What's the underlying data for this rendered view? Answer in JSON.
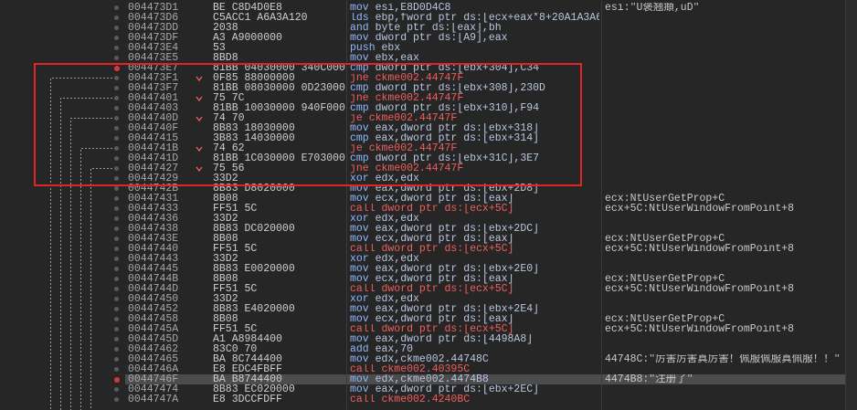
{
  "colors": {
    "background": "#262626",
    "address": "#a8a8a8",
    "bytes": "#cfcfcf",
    "mnemonic": "#8fb8ff",
    "operands": "#b9c6e0",
    "jump": "#ee5f5b",
    "comment": "#c8c8c8",
    "selected_row": "#4c4c4c",
    "breakpoint": "#e03434",
    "dot": "#5a5a5a",
    "annotation": "#e02525",
    "jump_line": "#9c9c9c"
  },
  "rows": [
    {
      "addr": "004473D1",
      "bytes": "BE C8D4D0E8",
      "mnem": "mov",
      "ops": "esi,E8D0D4C8",
      "comment": "esi:\"U褒翘頫,uD\""
    },
    {
      "addr": "004473D6",
      "bytes": "C5ACC1 A6A3A120",
      "mnem": "lds",
      "ops": "ebp,fword ptr ds:[ecx+eax*8+20A1A3A6"
    },
    {
      "addr": "004473DD",
      "bytes": "2038",
      "mnem": "and",
      "ops": "byte ptr ds:[eax],bh"
    },
    {
      "addr": "004473DF",
      "bytes": "A3 A9000000",
      "mnem": "mov",
      "ops": "dword ptr ds:[A9],eax"
    },
    {
      "addr": "004473E4",
      "bytes": "53",
      "mnem": "push",
      "ops": "ebx"
    },
    {
      "addr": "004473E5",
      "bytes": "8BD8",
      "mnem": "mov",
      "ops": "ebx,eax"
    },
    {
      "addr": "004473E7",
      "bytes": "81BB 04030000 340C000",
      "mnem": "cmp",
      "ops": "dword ptr ds:[ebx+304],C34",
      "breakpoint": true
    },
    {
      "addr": "004473F1",
      "bytes": "0F85 88000000",
      "mnem": "jne",
      "ops": "ckme002.44747F",
      "kind": "jcc"
    },
    {
      "addr": "004473F7",
      "bytes": "81BB 08030000 0D23000",
      "mnem": "cmp",
      "ops": "dword ptr ds:[ebx+308],230D"
    },
    {
      "addr": "00447401",
      "bytes": "75 7C",
      "mnem": "jne",
      "ops": "ckme002.44747F",
      "kind": "jcc"
    },
    {
      "addr": "00447403",
      "bytes": "81BB 10030000 940F000",
      "mnem": "cmp",
      "ops": "dword ptr ds:[ebx+310],F94"
    },
    {
      "addr": "0044740D",
      "bytes": "74 70",
      "mnem": "je",
      "ops": "ckme002.44747F",
      "kind": "jcc"
    },
    {
      "addr": "0044740F",
      "bytes": "8B83 18030000",
      "mnem": "mov",
      "ops": "eax,dword ptr ds:[ebx+318]"
    },
    {
      "addr": "00447415",
      "bytes": "3B83 14030000",
      "mnem": "cmp",
      "ops": "eax,dword ptr ds:[ebx+314]"
    },
    {
      "addr": "0044741B",
      "bytes": "74 62",
      "mnem": "je",
      "ops": "ckme002.44747F",
      "kind": "jcc"
    },
    {
      "addr": "0044741D",
      "bytes": "81BB 1C030000 E703000",
      "mnem": "cmp",
      "ops": "dword ptr ds:[ebx+31C],3E7"
    },
    {
      "addr": "00447427",
      "bytes": "75 56",
      "mnem": "jne",
      "ops": "ckme002.44747F",
      "kind": "jcc"
    },
    {
      "addr": "00447429",
      "bytes": "33D2",
      "mnem": "xor",
      "ops": "edx,edx"
    },
    {
      "addr": "0044742B",
      "bytes": "8B83 D8020000",
      "mnem": "mov",
      "ops": "eax,dword ptr ds:[ebx+2D8]"
    },
    {
      "addr": "00447431",
      "bytes": "8B08",
      "mnem": "mov",
      "ops": "ecx,dword ptr ds:[eax]",
      "comment": "ecx:NtUserGetProp+C"
    },
    {
      "addr": "00447433",
      "bytes": "FF51 5C",
      "mnem": "call",
      "ops": "dword ptr ds:[ecx+5C]",
      "comment": "ecx+5C:NtUserWindowFromPoint+8",
      "kind": "call"
    },
    {
      "addr": "00447436",
      "bytes": "33D2",
      "mnem": "xor",
      "ops": "edx,edx"
    },
    {
      "addr": "00447438",
      "bytes": "8B83 DC020000",
      "mnem": "mov",
      "ops": "eax,dword ptr ds:[ebx+2DC]"
    },
    {
      "addr": "0044743E",
      "bytes": "8B08",
      "mnem": "mov",
      "ops": "ecx,dword ptr ds:[eax]",
      "comment": "ecx:NtUserGetProp+C"
    },
    {
      "addr": "00447440",
      "bytes": "FF51 5C",
      "mnem": "call",
      "ops": "dword ptr ds:[ecx+5C]",
      "comment": "ecx+5C:NtUserWindowFromPoint+8",
      "kind": "call"
    },
    {
      "addr": "00447443",
      "bytes": "33D2",
      "mnem": "xor",
      "ops": "edx,edx"
    },
    {
      "addr": "00447445",
      "bytes": "8B83 E0020000",
      "mnem": "mov",
      "ops": "eax,dword ptr ds:[ebx+2E0]"
    },
    {
      "addr": "0044744B",
      "bytes": "8B08",
      "mnem": "mov",
      "ops": "ecx,dword ptr ds:[eax]",
      "comment": "ecx:NtUserGetProp+C"
    },
    {
      "addr": "0044744D",
      "bytes": "FF51 5C",
      "mnem": "call",
      "ops": "dword ptr ds:[ecx+5C]",
      "comment": "ecx+5C:NtUserWindowFromPoint+8",
      "kind": "call"
    },
    {
      "addr": "00447450",
      "bytes": "33D2",
      "mnem": "xor",
      "ops": "edx,edx"
    },
    {
      "addr": "00447452",
      "bytes": "8B83 E4020000",
      "mnem": "mov",
      "ops": "eax,dword ptr ds:[ebx+2E4]"
    },
    {
      "addr": "00447458",
      "bytes": "8B08",
      "mnem": "mov",
      "ops": "ecx,dword ptr ds:[eax]",
      "comment": "ecx:NtUserGetProp+C"
    },
    {
      "addr": "0044745A",
      "bytes": "FF51 5C",
      "mnem": "call",
      "ops": "dword ptr ds:[ecx+5C]",
      "comment": "ecx+5C:NtUserWindowFromPoint+8",
      "kind": "call"
    },
    {
      "addr": "0044745D",
      "bytes": "A1 A8984400",
      "mnem": "mov",
      "ops": "eax,dword ptr ds:[4498A8]"
    },
    {
      "addr": "00447462",
      "bytes": "83C0 70",
      "mnem": "add",
      "ops": "eax,70"
    },
    {
      "addr": "00447465",
      "bytes": "BA 8C744400",
      "mnem": "mov",
      "ops": "edx,ckme002.44748C",
      "comment": "44748C:\"厉害厉害真厉害！佩服佩服真佩服！！\""
    },
    {
      "addr": "0044746A",
      "bytes": "E8 EDC4FBFF",
      "mnem": "call",
      "ops": "ckme002.40395C",
      "kind": "call"
    },
    {
      "addr": "0044746F",
      "bytes": "BA B8744400",
      "mnem": "mov",
      "ops": "edx,ckme002.4474B8",
      "comment": "4474B8:\"注册了\"",
      "breakpoint": true,
      "selected": true
    },
    {
      "addr": "00447474",
      "bytes": "8B83 EC020000",
      "mnem": "mov",
      "ops": "eax,dword ptr ds:[ebx+2EC]"
    },
    {
      "addr": "0044747A",
      "bytes": "E8 3DCCFDFF",
      "mnem": "call",
      "ops": "ckme002.4240BC",
      "kind": "call"
    }
  ]
}
